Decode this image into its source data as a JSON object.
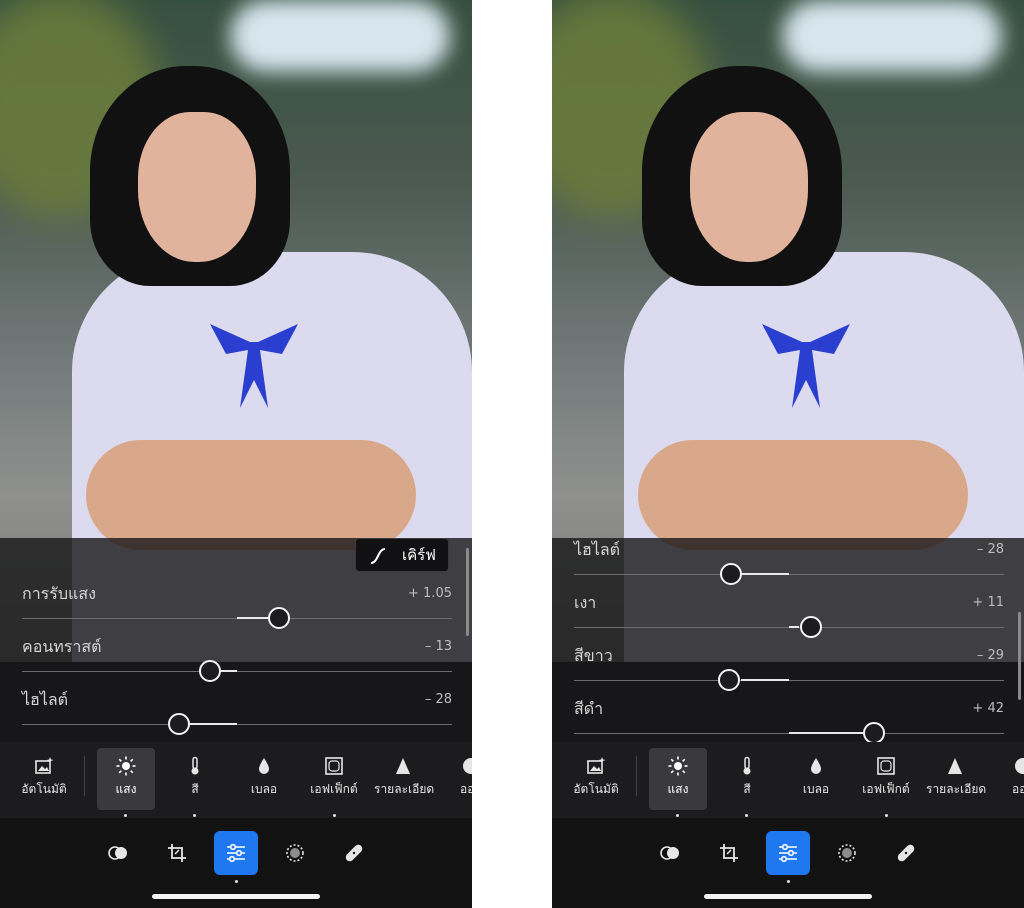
{
  "left": {
    "curve_button_label": "เคิร์ฟ",
    "sliders": [
      {
        "label": "การรับแสง",
        "value": "+ 1.05"
      },
      {
        "label": "คอนทราสต์",
        "value": "– 13"
      },
      {
        "label": "ไฮไลต์",
        "value": "– 28"
      }
    ],
    "categories": [
      {
        "label": "อัตโนมัติ",
        "icon": "auto-image-icon"
      },
      {
        "label": "แสง",
        "icon": "sun-icon"
      },
      {
        "label": "สี",
        "icon": "thermometer-icon"
      },
      {
        "label": "เบลอ",
        "icon": "drop-icon"
      },
      {
        "label": "เอฟเฟ็กต์",
        "icon": "vignette-icon"
      },
      {
        "label": "รายละเอียด",
        "icon": "triangle-icon"
      },
      {
        "label": "ออป",
        "icon": "optics-icon"
      }
    ]
  },
  "right": {
    "sliders": [
      {
        "label": "ไฮไลต์",
        "value": "– 28"
      },
      {
        "label": "เงา",
        "value": "+ 11"
      },
      {
        "label": "สีขาว",
        "value": "– 29"
      },
      {
        "label": "สีดำ",
        "value": "+ 42"
      }
    ],
    "categories": [
      {
        "label": "อัตโนมัติ",
        "icon": "auto-image-icon"
      },
      {
        "label": "แสง",
        "icon": "sun-icon"
      },
      {
        "label": "สี",
        "icon": "thermometer-icon"
      },
      {
        "label": "เบลอ",
        "icon": "drop-icon"
      },
      {
        "label": "เอฟเฟ็กต์",
        "icon": "vignette-icon"
      },
      {
        "label": "รายละเอียด",
        "icon": "triangle-icon"
      },
      {
        "label": "ออป",
        "icon": "optics-icon"
      }
    ]
  },
  "toolbar_icons": [
    "presets-icon",
    "crop-icon",
    "edit-sliders-icon",
    "masking-icon",
    "healing-icon"
  ],
  "colors": {
    "accent": "#1f78f0",
    "panel_bg": "#1c1c1e",
    "toolbar_bg": "#121212"
  }
}
